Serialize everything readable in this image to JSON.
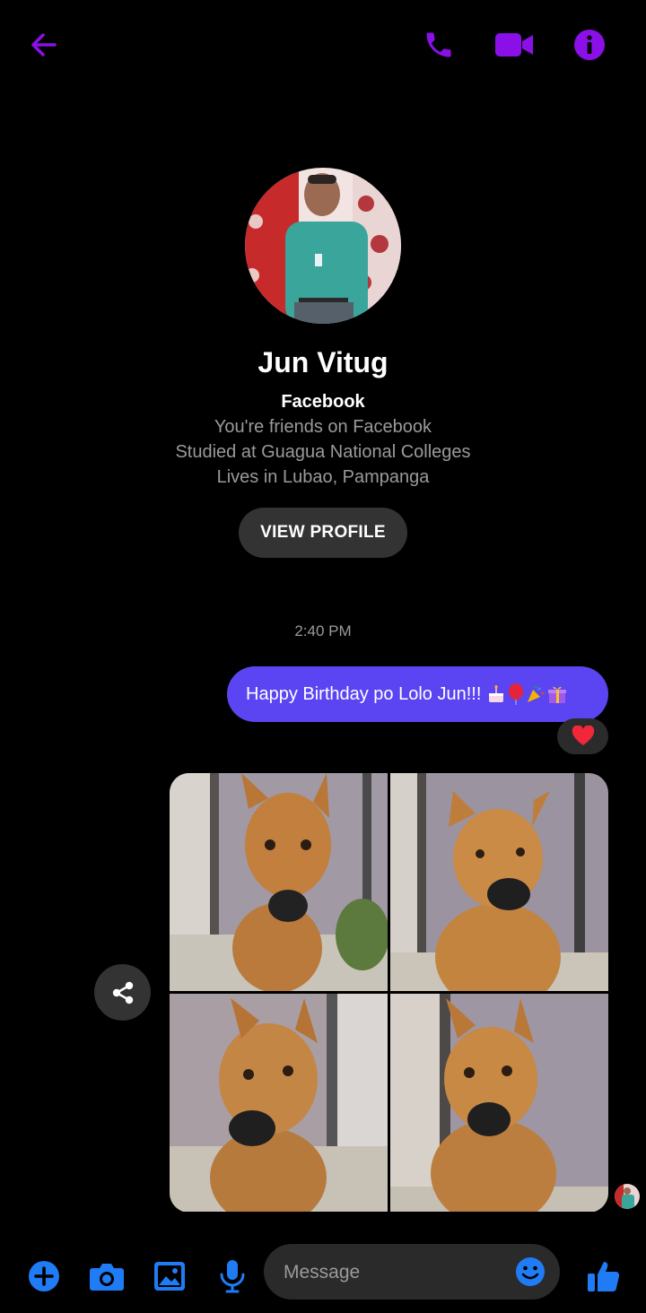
{
  "colors": {
    "accent": "#8b10e8",
    "blue": "#1f7cf5",
    "bubble": "#5b45f2"
  },
  "header": {
    "icons": [
      "back-arrow-icon",
      "phone-icon",
      "video-camera-icon",
      "info-icon"
    ]
  },
  "profile": {
    "name": "Jun Vitug",
    "source": "Facebook",
    "friends": "You're friends on Facebook",
    "studied": "Studied at Guagua National Colleges",
    "lives": "Lives in Lubao, Pampanga",
    "view_profile_label": "VIEW PROFILE"
  },
  "conversation": {
    "timestamp": "2:40 PM",
    "message_text": "Happy Birthday po Lolo Jun!!!",
    "message_emojis": [
      "cake",
      "balloon",
      "party-popper",
      "gift"
    ],
    "reaction": "heart",
    "photo_count": 4
  },
  "composer": {
    "placeholder": "Message",
    "icons": [
      "plus-icon",
      "camera-icon",
      "image-icon",
      "microphone-icon",
      "emoji-icon",
      "thumbs-up-icon"
    ]
  }
}
